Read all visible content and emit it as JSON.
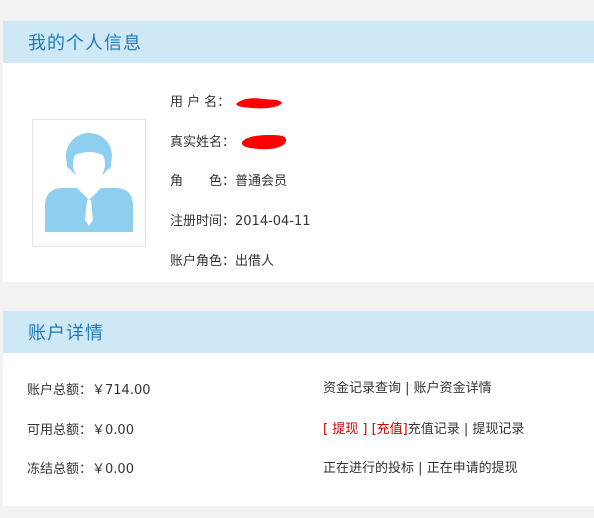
{
  "profile": {
    "title": "我的个人信息",
    "username_label": "用 户 名：",
    "realname_label": "真实姓名：",
    "role_label": "角　　色：",
    "role_value": "普通会员",
    "register_label": "注册时间：",
    "register_value": "2014-04-11",
    "account_role_label": "账户角色：",
    "account_role_value": "出借人",
    "redaction_color": "#ff0000",
    "avatar_color": "#8ecff0"
  },
  "account": {
    "title": "账户详情",
    "total_label": "账户总额：",
    "total_value": "￥714.00",
    "available_label": "可用总额：",
    "available_value": "￥0.00",
    "frozen_label": "冻结总额：",
    "frozen_value": "￥0.00",
    "row1": {
      "fund_record": "资金记录查询",
      "sep": " | ",
      "fund_detail": "账户资金详情"
    },
    "row2": {
      "withdraw": "[ 提现 ]",
      "recharge": "[充值]",
      "recharge_record": "充值记录",
      "sep": " | ",
      "withdraw_record": "提现记录"
    },
    "row3": {
      "bidding": "正在进行的投标",
      "sep": " | ",
      "applying": "正在申请的提现"
    }
  }
}
